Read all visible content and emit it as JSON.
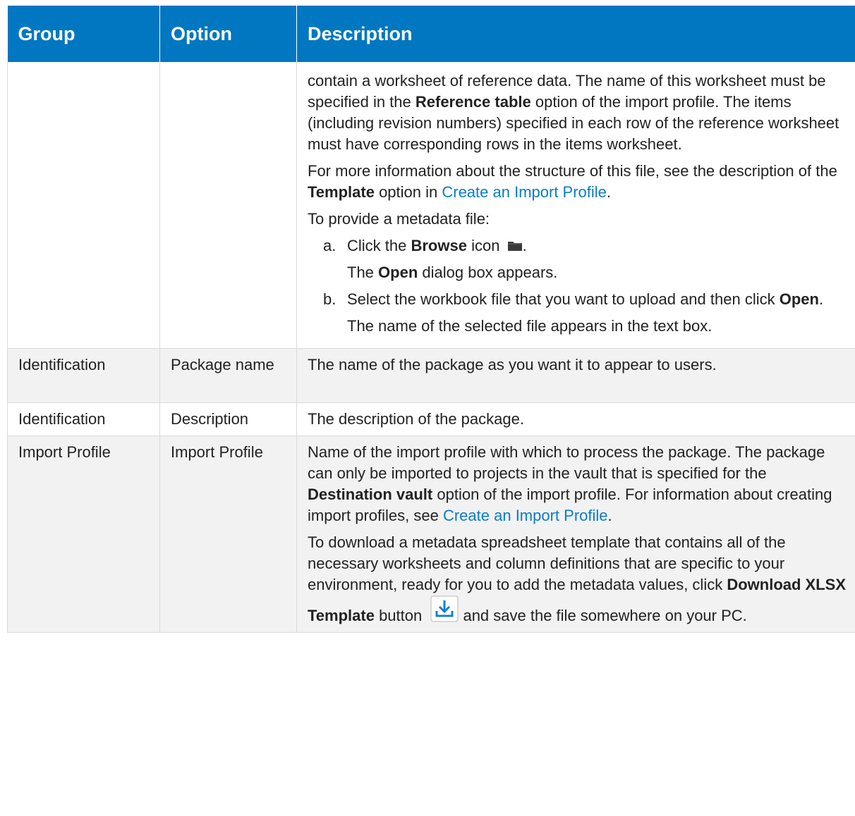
{
  "header": {
    "group": "Group",
    "option": "Option",
    "description": "Description"
  },
  "row_cont": {
    "p1": {
      "t1": "contain a worksheet of reference data. The name of this worksheet must be specified in the ",
      "b1": "Reference table",
      "t2": " option of the import profile. The items (including revision numbers) specified in each row of the reference worksheet must have corresponding rows in the items worksheet."
    },
    "p2": {
      "t1": "For more information about the structure of this file, see the description of the ",
      "b1": "Template",
      "t2": " option in ",
      "link": "Create an Import Profile",
      "t3": "."
    },
    "p3": "To provide a metadata file:",
    "step_a": {
      "marker": "a.",
      "t1": "Click the ",
      "b1": "Browse",
      "t2": " icon ",
      "t3": ".",
      "sub_b": "Open",
      "sub_t": " dialog box appears.",
      "sub_pre": "The "
    },
    "step_b": {
      "marker": "b.",
      "t1": "Select the workbook file that you want to upload and then click ",
      "b1": "Open",
      "t2": ".",
      "sub": "The name of the selected file appears in the text box."
    }
  },
  "rows": [
    {
      "group": "Identification",
      "option": "Package name",
      "description": "The name of the package as you want it to appear to users."
    },
    {
      "group": "Identification",
      "option": "Description",
      "description": "The description of the package."
    },
    {
      "group": "Import Profile",
      "option": "Import Profile"
    }
  ],
  "row_import": {
    "p1": {
      "t1": "Name of the import profile with which to process the package. The package can only be imported to projects in the vault that is specified for the ",
      "b1": "Destination vault",
      "t2": " option of the import profile. For information about creating import profiles, see ",
      "link": "Create an Import Profile",
      "t3": "."
    },
    "p2": {
      "t1": "To download a metadata spreadsheet template that contains all of the necessary worksheets and column definitions that are specific to your environment, ready for you to add the metadata values, click ",
      "b1": "Download XLSX Template",
      "t2": " button ",
      "t3": " and save the file somewhere on your PC."
    }
  },
  "icons": {
    "browse": "folder-icon",
    "download": "download-icon"
  },
  "colors": {
    "header_bg": "#0077c0",
    "link": "#0a7cc9",
    "alt_row": "#f2f2f2"
  }
}
